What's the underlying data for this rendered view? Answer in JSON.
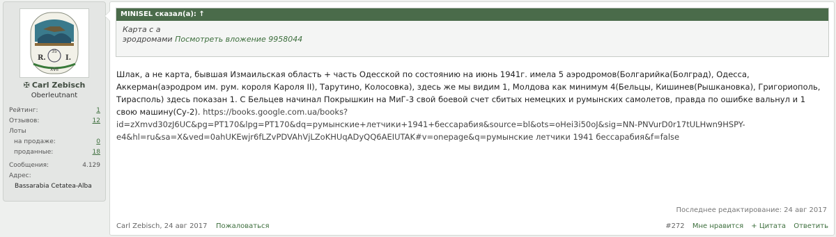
{
  "user": {
    "name_mark": "✠",
    "name": "Carl Zebisch",
    "title": "Oberleutnant",
    "stats": {
      "rating_label": "Рейтинг:",
      "rating_value": "1",
      "reviews_label": "Отзывов:",
      "reviews_value": "12",
      "lots_label": "Лоты",
      "on_sale_label": "на продаже:",
      "on_sale_value": "0",
      "sold_label": "проданные:",
      "sold_value": "18",
      "messages_label": "Сообщения:",
      "messages_value": "4.129",
      "address_label": "Адрес:",
      "address_value": "Bassarabia Cetatea-Alba"
    }
  },
  "quote": {
    "header": "MINISEL сказал(а): ↑",
    "line1": "Карта с а",
    "line2_prefix": "эродромами",
    "line2_link": "Посмотреть вложение 9958044"
  },
  "post": {
    "text": "Шлак, а не карта, бывшая Измаильская область + часть Одесской по состоянию на июнь 1941г. имела 5 аэродромов(Болгарийка(Болград), Одесса, Аккерман(аэродром им. рум. короля Кароля II), Тарутино, Колосовка), здесь же мы видим 1, Молдова как минимум 4(Бельцы, Кишинев(Рышкановка), Григориополь, Тирасполь) здесь показан 1. С Бельцев начинал Покрышкин на МиГ-3 свой боевой счет сбитых немецких и румынских самолетов, правда по ошибке вальнул и 1 свою машину(Су-2).",
    "url": "https://books.google.com.ua/books?id=zXmvd30zJ6UC&pg=PT170&lpg=PT170&dq=румынские+летчики+1941+бессарабия&source=bl&ots=oHei3i50oJ&sig=NN-PNVurD0r17tULHwn9HSPY-e4&hl=ru&sa=X&ved=0ahUKEwjr6fLZvPDVAhVjLZoKHUqADyQQ6AEIUTAK#v=onepage&q=румынские летчики 1941 бессарабия&f=false",
    "edited": "Последнее редактирование: 24 авг 2017"
  },
  "footer": {
    "author_date": "Carl Zebisch, 24 авг 2017",
    "report": "Пожаловаться",
    "post_number": "#272",
    "like": "Мне нравится",
    "quote": "+ Цитата",
    "reply": "Ответить"
  },
  "avatar": {
    "text_left": "R.",
    "text_right": "I.",
    "text_bottom": "XVII",
    "text_number": "35"
  }
}
